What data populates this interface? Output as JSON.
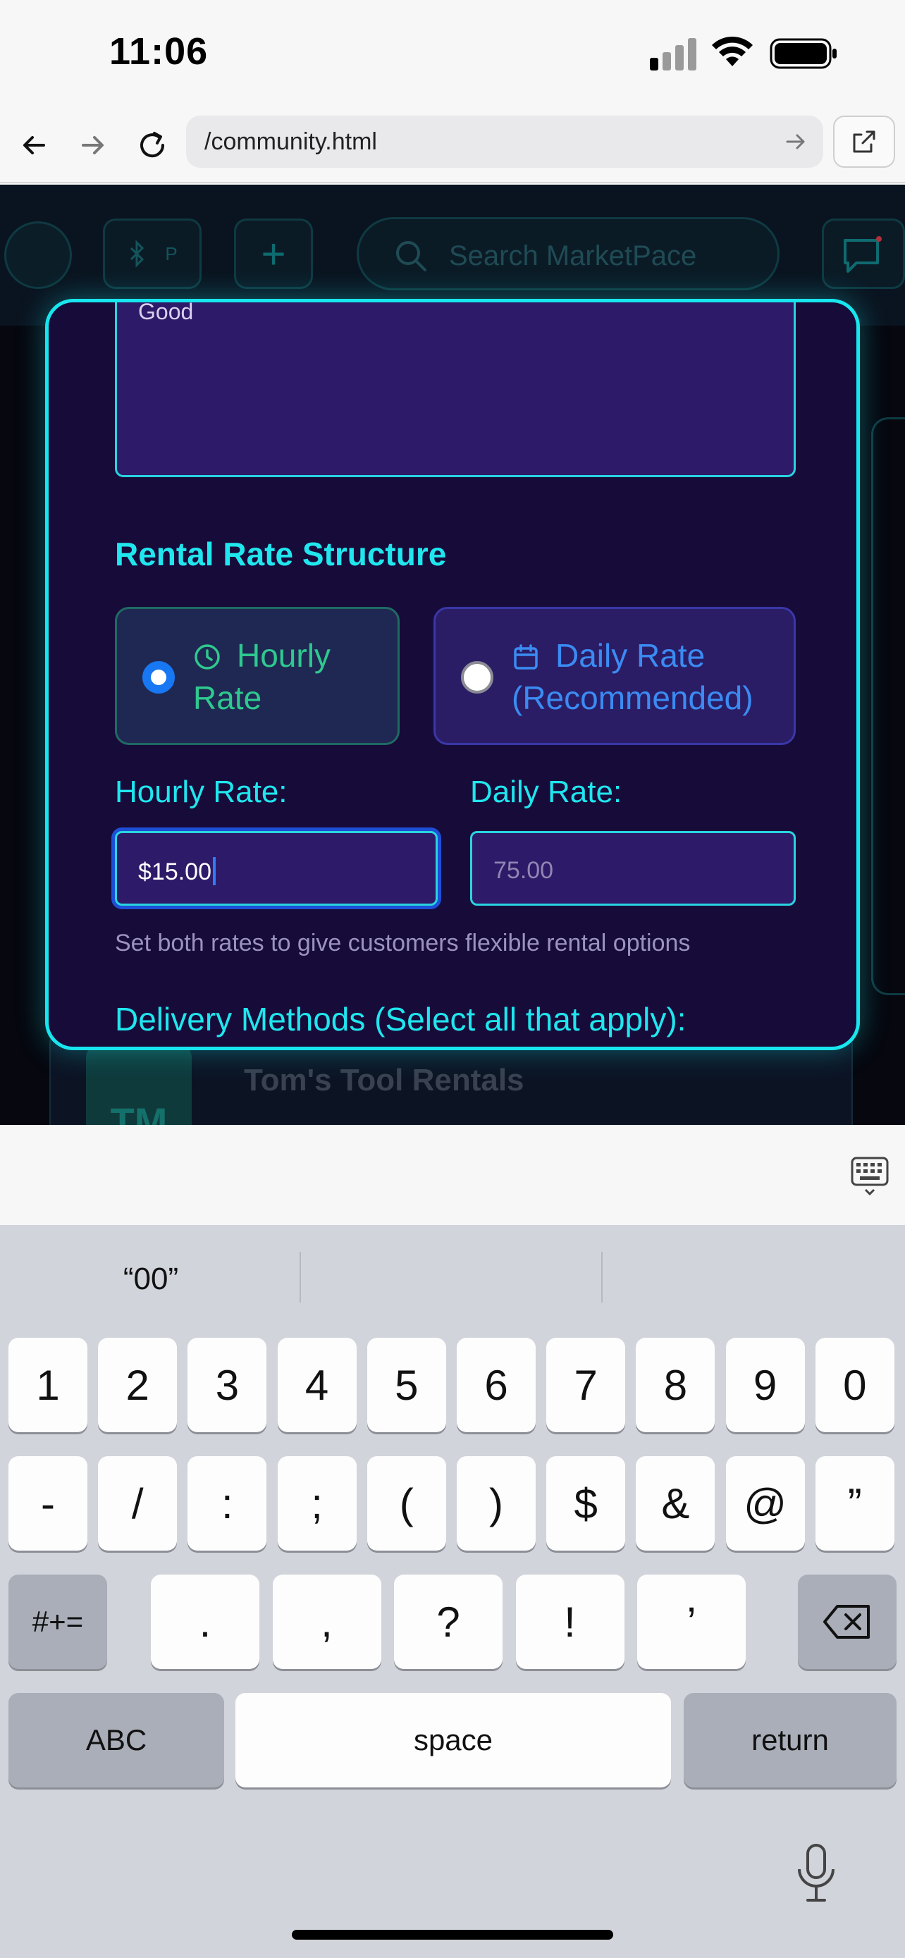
{
  "status_bar": {
    "time": "11:06"
  },
  "browser": {
    "url": "/community.html",
    "back_icon": "arrow-left-icon",
    "forward_icon": "arrow-right-icon",
    "reload_icon": "reload-icon",
    "share_icon": "open-external-icon"
  },
  "page_background": {
    "search_placeholder": "Search MarketPace",
    "header_pill_text": "P",
    "listing_initials": "TM",
    "listing_name": "Tom's Tool Rentals"
  },
  "modal": {
    "condition_text": "Good",
    "section_title": "Rental Rate Structure",
    "options": [
      {
        "label": "Hourly Rate",
        "selected": true,
        "icon": "clock-icon"
      },
      {
        "label": "Daily Rate (Recommended)",
        "selected": false,
        "icon": "calendar-icon"
      }
    ],
    "hourly_label": "Hourly Rate:",
    "hourly_value": "$15.00",
    "daily_label": "Daily Rate:",
    "daily_placeholder": "75.00",
    "helper_text": "Set both rates to give customers flexible rental options",
    "delivery_title": "Delivery Methods (Select all that apply):"
  },
  "keyboard": {
    "suggestion": "“00”",
    "row1": [
      "1",
      "2",
      "3",
      "4",
      "5",
      "6",
      "7",
      "8",
      "9",
      "0"
    ],
    "row2": [
      "-",
      "/",
      ":",
      ";",
      "(",
      ")",
      "$",
      "&",
      "@",
      "”"
    ],
    "row3": [
      ".",
      ",",
      "?",
      "!",
      "’"
    ],
    "symbols_key": "#+=",
    "abc_key": "ABC",
    "space_key": "space",
    "return_key": "return"
  },
  "colors": {
    "accent_cyan": "#18e6ee",
    "modal_bg": "#170b3a",
    "hourly_green": "#2ec98f",
    "daily_blue": "#3b8bf2",
    "selected_radio": "#1877f2"
  }
}
